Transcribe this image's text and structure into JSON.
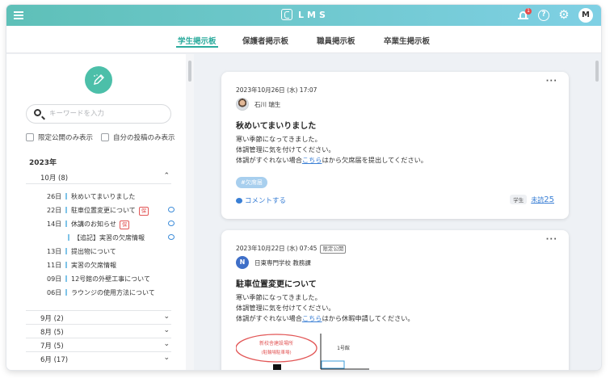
{
  "app": {
    "title": "LMS",
    "notification_count": "1",
    "user_initial": "M"
  },
  "icons": {
    "menu": "hamburger-icon",
    "bell": "bell-icon",
    "help": "question-icon",
    "settings": "gear-icon"
  },
  "colors": {
    "accent": "#2bab9d",
    "link": "#3a7fd5",
    "tag_red": "#e25656",
    "header_from": "#5ec0b8",
    "header_to": "#7fd0e4"
  },
  "tabs": [
    {
      "label": "学生掲示板",
      "active": true
    },
    {
      "label": "保護者掲示板"
    },
    {
      "label": "職員掲示板"
    },
    {
      "label": "卒業生掲示板"
    }
  ],
  "sidebar": {
    "search_placeholder": "キーワードを入力",
    "filters": [
      "限定公開のみ表示",
      "自分の投稿のみ表示"
    ],
    "year": "2023年",
    "open_month": "10月 (8)",
    "posts": [
      {
        "day": "26日",
        "title": "秋めいてまいりました"
      },
      {
        "day": "22日",
        "title": "駐車位置変更について",
        "tag": "保"
      },
      {
        "day": "14日",
        "title": "休講のお知らせ",
        "tag": "保"
      },
      {
        "day": "",
        "title": "【追記】実習の欠席情報"
      },
      {
        "day": "13日",
        "title": "提出物について"
      },
      {
        "day": "11日",
        "title": "実習の欠席情報"
      },
      {
        "day": "09日",
        "title": "12号館の外壁工事について"
      },
      {
        "day": "06日",
        "title": "ラウンジの使用方法について"
      }
    ],
    "months": [
      "9月 (2)",
      "8月 (5)",
      "7月 (5)",
      "6月 (17)"
    ]
  },
  "posts": [
    {
      "date": "2023年10月26日 (水) 17:07",
      "author": "石川 瑞生",
      "title": "秋めいてまいりました",
      "lines": [
        "寒い季節になってきました。",
        "体調管理に気を付けてください。"
      ],
      "line3_pre": "体調がすぐれない場合",
      "line3_link": "こちら",
      "line3_post": "はから欠席届を提出してください。",
      "tag": "#欠席届",
      "comment": "コメントする",
      "group": "学生",
      "unread_label": "未読",
      "unread_count": "25"
    },
    {
      "date": "2023年10月22日 (水) 07:45",
      "limited": "限定公開",
      "author_initial": "N",
      "author": "日東専門学校 教務課",
      "title": "駐車位置変更について",
      "lines": [
        "寒い季節になってきました。",
        "体調管理に気を付けてください。"
      ],
      "line3_pre": "体調がすぐれない場合",
      "line3_link": "こちら",
      "line3_post": "はから休暇申請してください。",
      "map_label1": "新校舎建設場所",
      "map_label2": "(駐輪場駐車場)",
      "map_building": "1号館"
    }
  ]
}
